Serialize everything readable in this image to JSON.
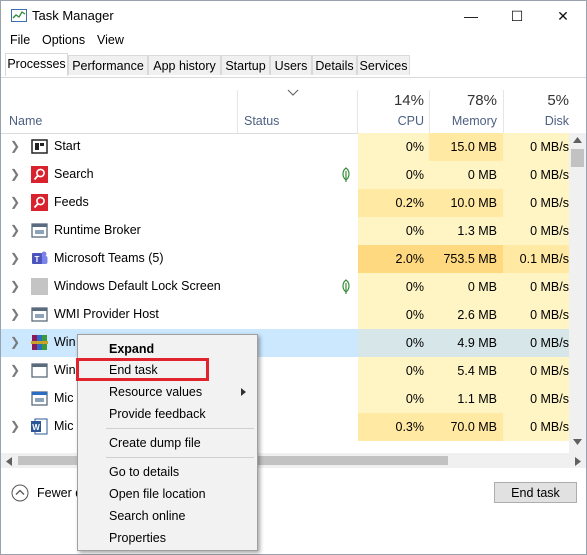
{
  "window": {
    "title": "Task Manager",
    "minimize_glyph": "—",
    "maximize_glyph": "☐",
    "close_glyph": "✕"
  },
  "menu": [
    "File",
    "Options",
    "View"
  ],
  "tabs": [
    "Processes",
    "Performance",
    "App history",
    "Startup",
    "Users",
    "Details",
    "Services"
  ],
  "header": {
    "name": "Name",
    "status": "Status",
    "cpu": {
      "pct": "14%",
      "label": "CPU"
    },
    "memory": {
      "pct": "78%",
      "label": "Memory"
    },
    "disk": {
      "pct": "5%",
      "label": "Disk"
    }
  },
  "rows": [
    {
      "name": "Start",
      "icon": "start-icon",
      "leaf": false,
      "cpu": "0%",
      "mem": "15.0 MB",
      "disk": "0 MB/s"
    },
    {
      "name": "Search",
      "icon": "search-icon",
      "leaf": true,
      "cpu": "0%",
      "mem": "0 MB",
      "disk": "0 MB/s"
    },
    {
      "name": "Feeds",
      "icon": "feeds-icon",
      "leaf": false,
      "cpu": "0.2%",
      "mem": "10.0 MB",
      "disk": "0 MB/s"
    },
    {
      "name": "Runtime Broker",
      "icon": "runtime-broker-icon",
      "leaf": false,
      "cpu": "0%",
      "mem": "1.3 MB",
      "disk": "0 MB/s"
    },
    {
      "name": "Microsoft Teams (5)",
      "icon": "teams-icon",
      "leaf": false,
      "cpu": "2.0%",
      "mem": "753.5 MB",
      "disk": "0.1 MB/s"
    },
    {
      "name": "Windows Default Lock Screen",
      "icon": "lock-screen-icon",
      "leaf": true,
      "cpu": "0%",
      "mem": "0 MB",
      "disk": "0 MB/s"
    },
    {
      "name": "WMI Provider Host",
      "icon": "wmi-icon",
      "leaf": false,
      "cpu": "0%",
      "mem": "2.6 MB",
      "disk": "0 MB/s"
    },
    {
      "name": "Win",
      "icon": "winrar-icon",
      "leaf": false,
      "cpu": "0%",
      "mem": "4.9 MB",
      "disk": "0 MB/s",
      "selected": true
    },
    {
      "name": "Win",
      "icon": "window-icon",
      "leaf": false,
      "cpu": "0%",
      "mem": "5.4 MB",
      "disk": "0 MB/s"
    },
    {
      "name": "Mic",
      "icon": "app-icon",
      "leaf": false,
      "cpu": "0%",
      "mem": "1.1 MB",
      "disk": "0 MB/s"
    },
    {
      "name": "Mic",
      "icon": "word-icon",
      "leaf": false,
      "cpu": "0.3%",
      "mem": "70.0 MB",
      "disk": "0 MB/s"
    }
  ],
  "context_menu": {
    "expand": "Expand",
    "end_task": "End task",
    "resource_values": "Resource values",
    "provide_feedback": "Provide feedback",
    "create_dump_file": "Create dump file",
    "go_to_details": "Go to details",
    "open_file_location": "Open file location",
    "search_online": "Search online",
    "properties": "Properties"
  },
  "footer": {
    "fewer_details": "Fewer d",
    "end_task_button": "End task"
  },
  "colors": {
    "selection": "#cce8ff",
    "heat_light": "#fff4c4",
    "heat_mid": "#ffe9a3",
    "heat_strong": "#ffd980",
    "highlight": "#e0242e"
  }
}
